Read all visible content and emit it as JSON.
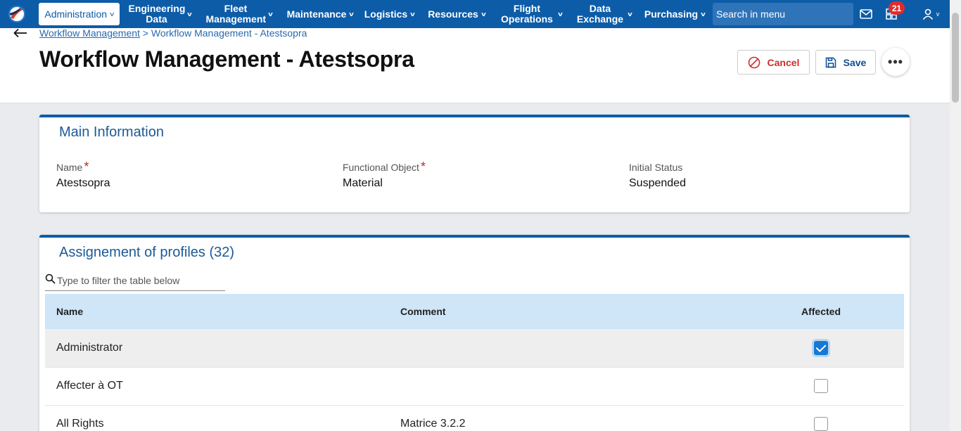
{
  "nav": {
    "items": [
      {
        "label": "Administration",
        "active": true
      },
      {
        "label": "Engineering Data"
      },
      {
        "label": "Fleet Management"
      },
      {
        "label": "Maintenance"
      },
      {
        "label": "Logistics"
      },
      {
        "label": "Resources"
      },
      {
        "label": "Flight Operations"
      },
      {
        "label": "Data Exchange"
      },
      {
        "label": "Purchasing"
      }
    ],
    "search_label": "Search in menu",
    "notification_count": "21",
    "icons": [
      "mail-icon",
      "dashboard-icon",
      "user-icon"
    ]
  },
  "breadcrumb": {
    "parent": "Workflow Management",
    "separator": " > ",
    "current": "Workflow Management - Atestsopra"
  },
  "page": {
    "title": "Workflow Management - Atestsopra",
    "cancel_label": "Cancel",
    "save_label": "Save",
    "more_label": "•••"
  },
  "main_info": {
    "title": "Main Information",
    "fields": [
      {
        "label": "Name",
        "required": true,
        "value": "Atestsopra"
      },
      {
        "label": "Functional Object",
        "required": true,
        "value": "Material"
      },
      {
        "label": "Initial Status",
        "required": false,
        "value": "Suspended"
      }
    ],
    "required_mark": "*"
  },
  "profiles": {
    "title": "Assignement of profiles (32)",
    "filter_placeholder": "Type to filter the table below",
    "columns": {
      "name": "Name",
      "comment": "Comment",
      "affected": "Affected"
    },
    "rows": [
      {
        "name": "Administrator",
        "comment": "",
        "affected": true
      },
      {
        "name": "Affecter à OT",
        "comment": "",
        "affected": false
      },
      {
        "name": "All Rights",
        "comment": "Matrice 3.2.2",
        "affected": false
      }
    ]
  },
  "colors": {
    "nav_bg": "#0d5ca8",
    "accent": "#1c5a96",
    "cancel": "#d12d2d",
    "header_row": "#cfe5f8",
    "badge": "#e32b2b"
  }
}
